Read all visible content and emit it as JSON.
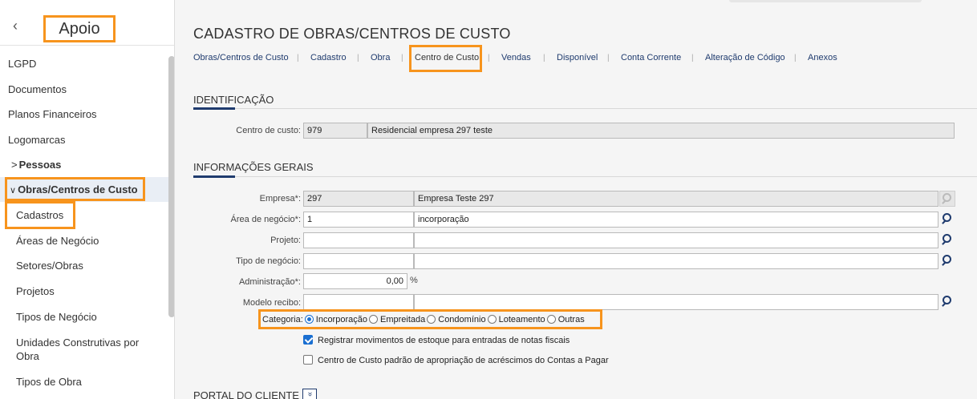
{
  "sidebar": {
    "back_icon": "chevron-left-icon",
    "title": "Apoio",
    "items": [
      {
        "label": "LGPD"
      },
      {
        "label": "Documentos"
      },
      {
        "label": "Planos Financeiros"
      },
      {
        "label": "Logomarcas"
      },
      {
        "label": "Pessoas",
        "expanded": false
      },
      {
        "label": "Obras/Centros de Custo",
        "expanded": true
      },
      {
        "label": "Cadastros"
      },
      {
        "label": "Áreas de Negócio"
      },
      {
        "label": "Setores/Obras"
      },
      {
        "label": "Projetos"
      },
      {
        "label": "Tipos de Negócio"
      },
      {
        "label": "Unidades Construtivas por"
      },
      {
        "label": "Obra"
      },
      {
        "label": "Tipos de Obra"
      }
    ],
    "chevron_right": ">",
    "chevron_down": "∨"
  },
  "page": {
    "title": "CADASTRO DE OBRAS/CENTROS DE CUSTO",
    "tabs": [
      {
        "label": "Obras/Centros de Custo"
      },
      {
        "label": "Cadastro"
      },
      {
        "label": "Obra"
      },
      {
        "label": "Centro de Custo",
        "active": true
      },
      {
        "label": "Vendas"
      },
      {
        "label": "Disponível"
      },
      {
        "label": "Conta Corrente"
      },
      {
        "label": "Alteração de Código"
      },
      {
        "label": "Anexos"
      }
    ],
    "tab_separator": "|"
  },
  "identificacao": {
    "heading": "IDENTIFICAÇÃO",
    "centro_label": "Centro de custo:",
    "centro_code": "979",
    "centro_name": "Residencial empresa 297 teste"
  },
  "informacoes": {
    "heading": "INFORMAÇÕES GERAIS",
    "empresa_label": "Empresa*:",
    "empresa_code": "297",
    "empresa_name": "Empresa Teste 297",
    "area_label": "Área de negócio*:",
    "area_code": "1",
    "area_name": "incorporação",
    "projeto_label": "Projeto:",
    "projeto_code": "",
    "projeto_name": "",
    "tipo_label": "Tipo de negócio:",
    "tipo_code": "",
    "tipo_name": "",
    "admin_label": "Administração*:",
    "admin_value": "0,00",
    "admin_unit": "%",
    "modelo_label": "Modelo recibo:",
    "modelo_code": "",
    "modelo_name": "",
    "categoria_label": "Categoria:",
    "categorias": [
      {
        "label": "Incorporação",
        "selected": true
      },
      {
        "label": "Empreitada",
        "selected": false
      },
      {
        "label": "Condomínio",
        "selected": false
      },
      {
        "label": "Loteamento",
        "selected": false
      },
      {
        "label": "Outras",
        "selected": false
      }
    ],
    "checkbox_estoque": {
      "label": "Registrar movimentos de estoque para entradas de notas fiscais",
      "checked": true
    },
    "checkbox_padrao": {
      "label": "Centro de Custo padrão de apropriação de acréscimos do Contas a Pagar",
      "checked": false
    }
  },
  "portal": {
    "heading": "PORTAL DO CLIENTE",
    "expand_icon": "double-chevron-down-icon",
    "expand_glyph": "»"
  },
  "colors": {
    "accent": "#1f3b6e",
    "highlight": "#f7941d",
    "radio": "#1a6fd1"
  }
}
